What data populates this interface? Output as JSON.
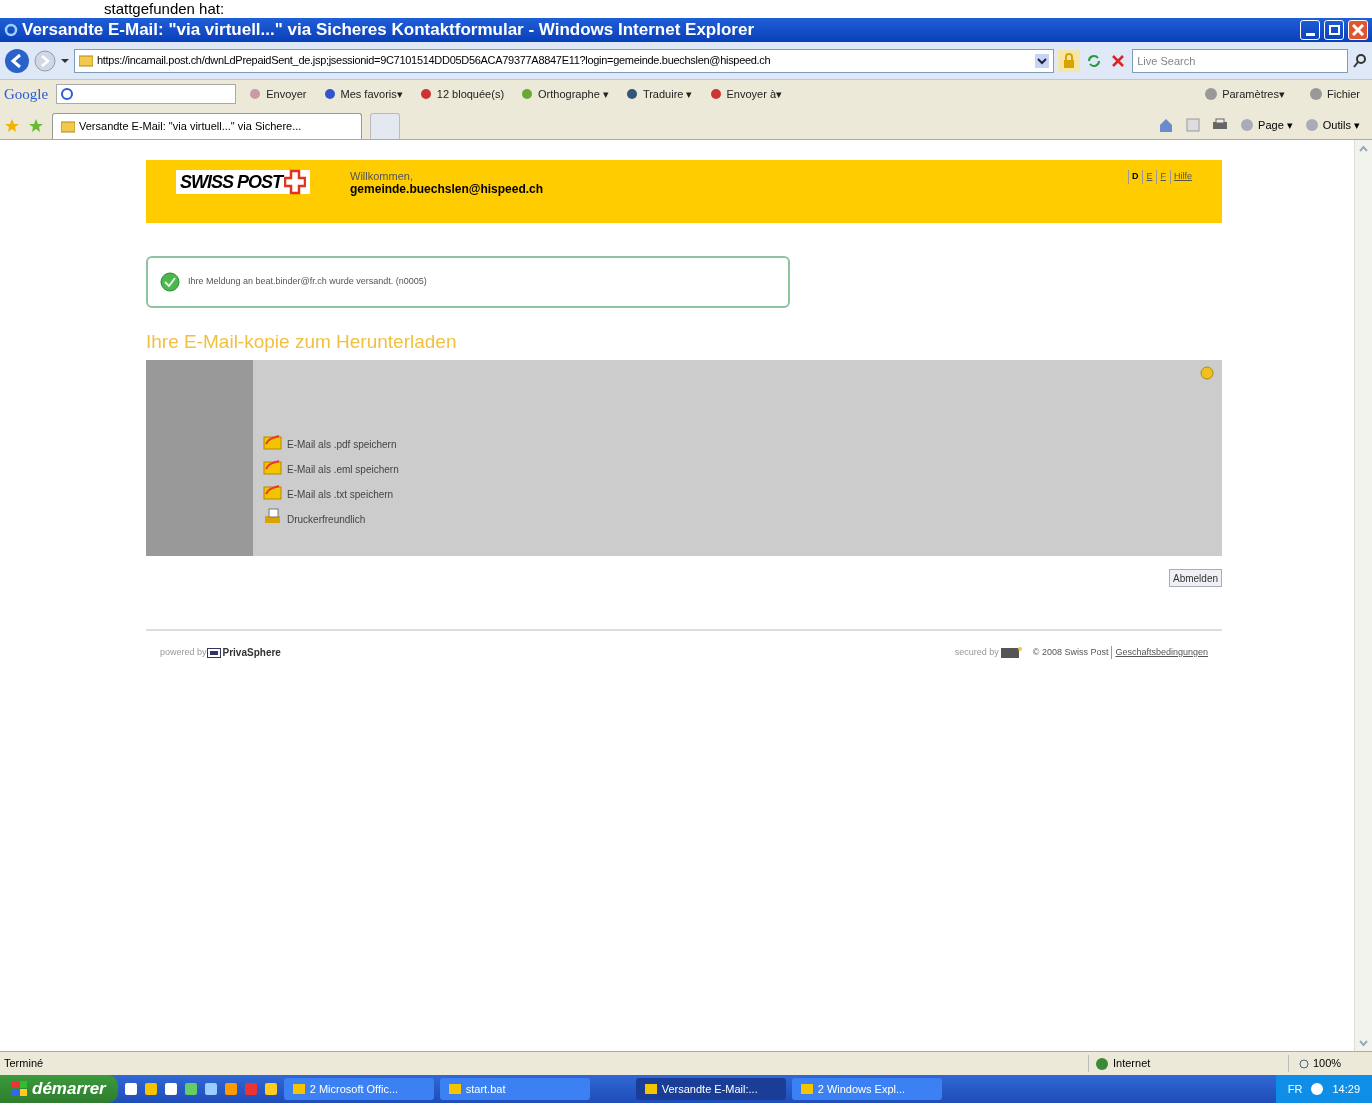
{
  "document_caption": "stattgefunden hat:",
  "window": {
    "title": "Versandte E-Mail: \"via virtuell...\" via Sicheres Kontaktformular - Windows Internet Explorer"
  },
  "address_bar": {
    "url": "https://incamail.post.ch/dwnLdPrepaidSent_de.jsp;jsessionid=9C7101514DD05D56ACA79377A8847E11?login=gemeinde.buechslen@hispeed.ch",
    "search_placeholder": "Live Search"
  },
  "google_toolbar": {
    "logo": "Google",
    "left_items": [
      {
        "label": "Envoyer"
      },
      {
        "label": "Mes favoris▾"
      },
      {
        "label": "12 bloquée(s)"
      },
      {
        "label": "Orthographe ▾"
      },
      {
        "label": "Traduire ▾"
      },
      {
        "label": "Envoyer à▾"
      }
    ],
    "right_items": [
      {
        "label": "Paramètres▾"
      },
      {
        "label": "Fichier"
      }
    ]
  },
  "tabs": [
    {
      "label": "Versandte E-Mail: \"via virtuell...\" via Sichere...",
      "selected": true
    }
  ],
  "command_bar": [
    {
      "label": "Page ▾"
    },
    {
      "label": "Outils ▾"
    }
  ],
  "page": {
    "logo": "SWISS POST",
    "welcome": "Willkommen,",
    "user": "gemeinde.buechslen@hispeed.ch",
    "languages": [
      {
        "label": "D",
        "selected": true
      },
      {
        "label": "E",
        "selected": false
      },
      {
        "label": "F",
        "selected": false
      }
    ],
    "help_link": "Hilfe",
    "message": "Ihre Meldung an beat.binder@fr.ch wurde versandt. (n0005)",
    "heading": "Ihre E-Mail-kopie zum Herunterladen",
    "actions": [
      {
        "kind": "save",
        "label": "E-Mail als .pdf speichern"
      },
      {
        "kind": "save",
        "label": "E-Mail als .eml speichern"
      },
      {
        "kind": "save",
        "label": "E-Mail als .txt speichern"
      },
      {
        "kind": "print",
        "label": "Druckerfreundlich"
      }
    ],
    "logout_button": "Abmelden",
    "footer_left_prefix": "powered by",
    "footer_left_brand": "PrivaSphere",
    "footer_secured": "secured by",
    "footer_copyright": "© 2008 Swiss Post",
    "footer_link": "Geschaftsbedingungen"
  },
  "status_bar": {
    "text": "Terminé",
    "zone": "Internet",
    "zoom": "100%"
  },
  "taskbar": {
    "start": "démarrer",
    "buttons": [
      {
        "label": "2 Microsoft Offic...",
        "selected": false
      },
      {
        "label": "start.bat",
        "selected": false
      },
      {
        "label": "Versandte E-Mail:...",
        "selected": true
      },
      {
        "label": "2 Windows Expl...",
        "selected": false
      }
    ],
    "language": "FR",
    "clock": "14:29"
  }
}
